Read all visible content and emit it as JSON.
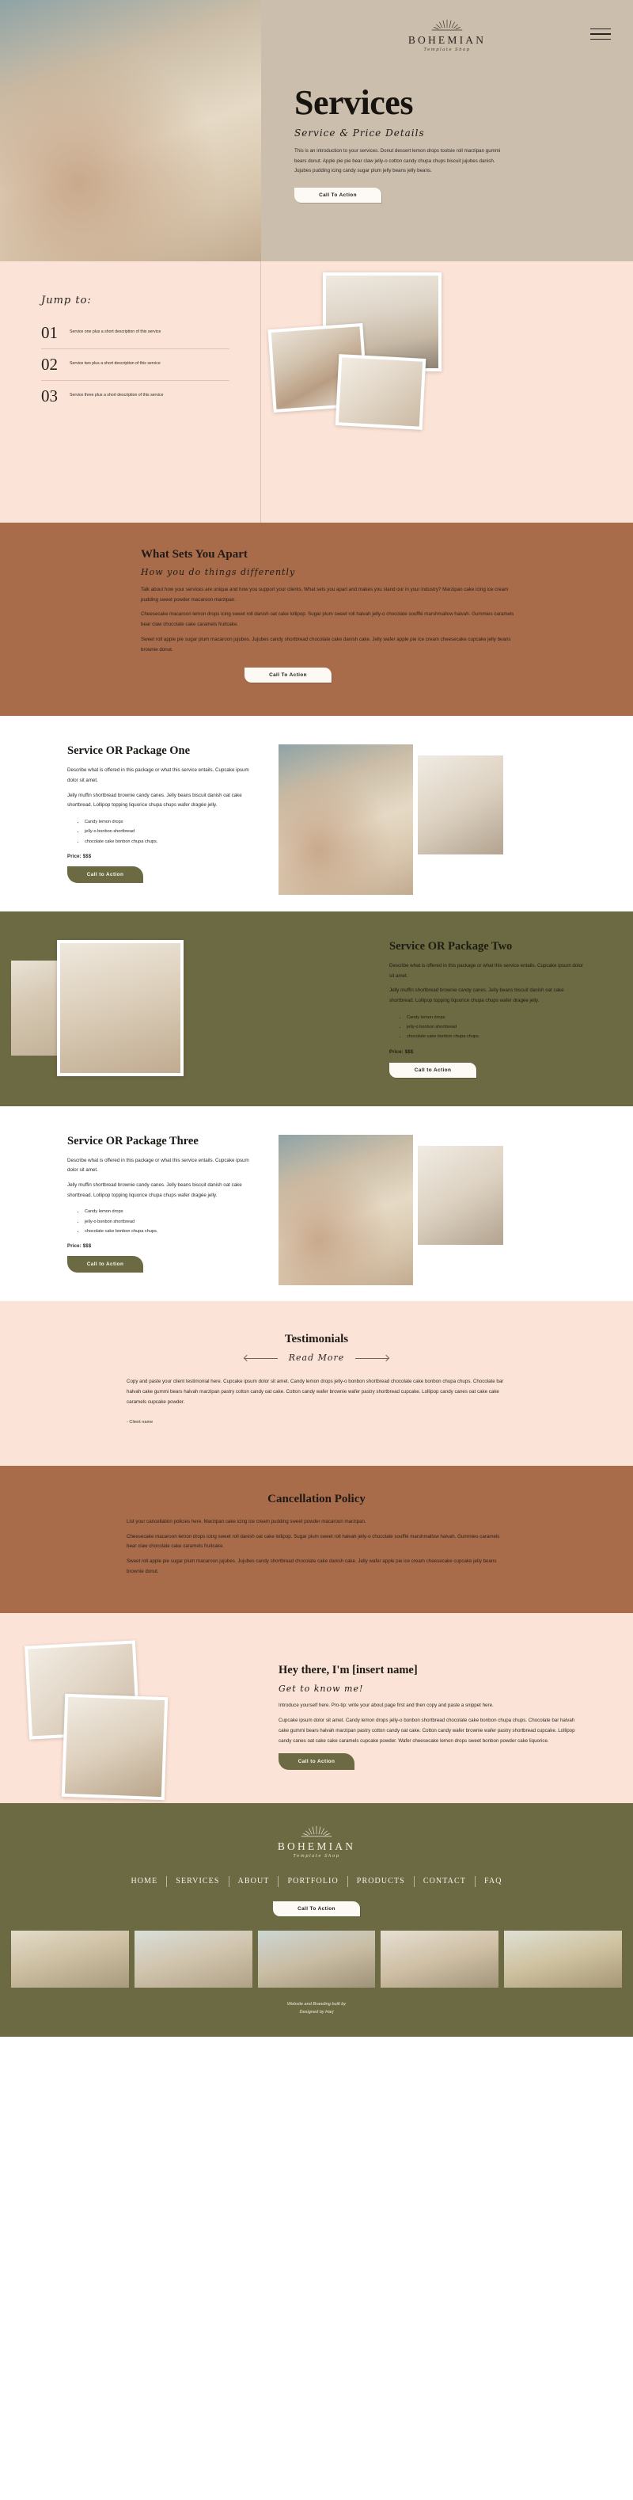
{
  "brand": {
    "name": "BOHEMIAN",
    "tagline": "Template Shop",
    "logo_icon": "sunburst-icon"
  },
  "colors": {
    "hero_bg": "#cbbeac",
    "blush": "#fbe4d7",
    "terracotta": "#a96c4b",
    "olive": "#6b6a42",
    "cream": "#fdfaf5",
    "ink": "#1d1915"
  },
  "hero": {
    "menu_icon": "hamburger-menu-icon",
    "title": "Services",
    "subtitle": "Service & Price Details",
    "body": "This is an introduction to your services. Donut dessert lemon drops tootsie roll marzipan gummi bears donut. Apple pie pie bear claw jelly-o cotton candy chupa chups biscuit jujubes danish. Jujubes pudding icing candy sugar plum jelly beans jelly beans.",
    "cta": "Call To Action"
  },
  "jump": {
    "title": "Jump to:",
    "items": [
      {
        "num": "01",
        "desc": "Service one plus a short description of this service"
      },
      {
        "num": "02",
        "desc": "Service two plus a short description of this service"
      },
      {
        "num": "03",
        "desc": "Service three plus a short description of this service"
      }
    ]
  },
  "apart": {
    "heading": "What Sets You Apart",
    "subheading": "How you do things differently",
    "p1": "Talk about how your services are unique and how you support your clients. What sets you apart and makes you stand our in your industry? Marzipan cake icing ice cream pudding sweet powder macaroon marzipan.",
    "p2": "Cheesecake macaroon lemon drops icing sweet roll danish oat cake lollipop. Sugar plum sweet roll halvah jelly-o chocolate soufflé marshmallow halvah. Gummies caramels bear claw chocolate cake caramels fruitcake.",
    "p3": "Sweet roll apple pie sugar plum macaroon jujubes. Jujubes candy shortbread chocolate cake danish cake. Jelly wafer apple pie ice cream cheesecake cupcake jelly beans brownie donut.",
    "cta": "Call To Action"
  },
  "packages": [
    {
      "heading": "Service OR Package One",
      "p1": "Describe what is offered in this package or what this service entails. Cupcake ipsum dolor sit amet.",
      "p2": "Jelly muffin shortbread brownie candy canes. Jelly beans biscuit danish oat cake shortbread. Lollipop topping liquorice chupa chups wafer dragée jelly.",
      "bullets": [
        "Candy lemon drops",
        "jelly-o bonbon shortbread",
        "chocolate cake bonbon chupa chups."
      ],
      "price": "Price: $$$",
      "cta": "Call to Action"
    },
    {
      "heading": "Service OR Package Two",
      "p1": "Describe what is offered in this package or what this service entails. Cupcake ipsum dolor sit amet.",
      "p2": "Jelly muffin shortbread brownie candy canes. Jelly beans biscuit danish oat cake shortbread. Lollipop topping liquorice chupa chups wafer dragée jelly.",
      "bullets": [
        "Candy lemon drops",
        "jelly-o bonbon shortbread",
        "chocolate cake bonbon chupa chups."
      ],
      "price": "Price: $$$",
      "cta": "Call to Action"
    },
    {
      "heading": "Service OR Package Three",
      "p1": "Describe what is offered in this package or what this service entails. Cupcake ipsum dolor sit amet.",
      "p2": "Jelly muffin shortbread brownie candy canes. Jelly beans biscuit danish oat cake shortbread. Lollipop topping liquorice chupa chups wafer dragée jelly.",
      "bullets": [
        "Candy lemon drops",
        "jelly-o bonbon shortbread",
        "chocolate cake bonbon chupa chups."
      ],
      "price": "Price: $$$",
      "cta": "Call to Action"
    }
  ],
  "testimonials": {
    "heading": "Testimonials",
    "read_more": "Read More",
    "prev_icon": "arrow-left-icon",
    "next_icon": "arrow-right-icon",
    "quote": "Copy and paste your client testimonial here. Cupcake ipsum dolor sit amet. Candy lemon drops jelly-o bonbon shortbread chocolate cake bonbon chupa chups. Chocolate bar halvah cake gummi bears halvah marzipan pastry cotton candy oat cake. Cotton candy wafer brownie wafer pastry shortbread cupcake. Lollipop candy canes oat cake cake caramels cupcake powder.",
    "author": "- Client name"
  },
  "cancellation": {
    "heading": "Cancellation Policy",
    "p1": "List your cancellation policies here. Marzipan cake icing ice cream pudding sweet powder macaroon marzipan.",
    "p2": "Cheesecake macaroon lemon drops icing sweet roll danish oat cake lollipop. Sugar plum sweet roll halvah jelly-o chocolate soufflé marshmallow halvah. Gummies caramels bear claw chocolate cake caramels fruitcake.",
    "p3": "Sweet roll apple pie sugar plum macaroon jujubes. Jujubes candy shortbread chocolate cake danish cake. Jelly wafer apple pie ice cream cheesecake cupcake jelly beans brownie donut."
  },
  "about": {
    "heading": "Hey there, I'm [insert name]",
    "subheading": "Get to know me!",
    "p1": "Introduce yourself here. Pro-tip: write your about page first and then copy and paste a snippet here.",
    "p2": "Cupcake ipsum dolor sit amet. Candy lemon drops jelly-o bonbon shortbread chocolate cake bonbon chupa chups. Chocolate bar halvah cake gummi bears halvah marzipan pastry cotton candy oat cake. Cotton candy wafer brownie wafer pastry shortbread cupcake. Lollipop candy canes oat cake cake caramels cupcake powder. Wafer cheesecake lemon drops sweet bonbon powder cake liquorice.",
    "cta": "Call to Action"
  },
  "footer": {
    "nav": [
      "HOME",
      "SERVICES",
      "ABOUT",
      "PORTFOLIO",
      "PRODUCTS",
      "CONTACT",
      "FAQ"
    ],
    "cta": "Call To Action",
    "credit_line1": "Website and Branding built by",
    "credit_line2": "Designed by Harj"
  }
}
